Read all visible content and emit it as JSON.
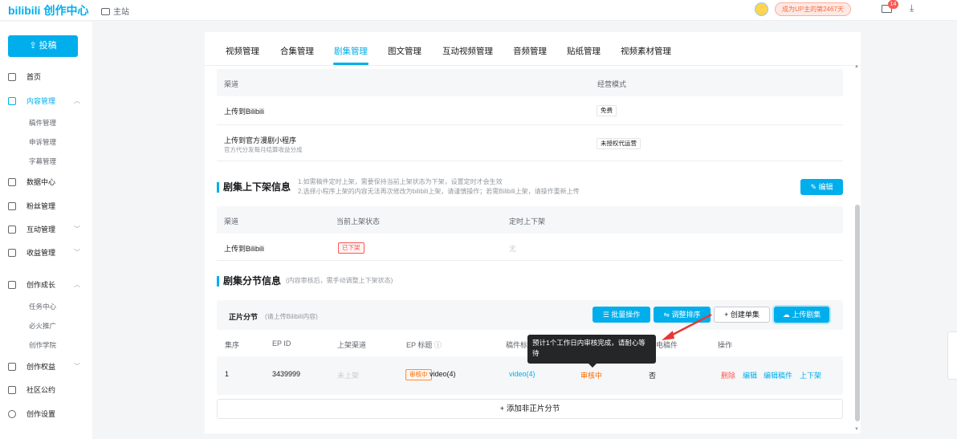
{
  "header": {
    "logo": "bilibili",
    "logo_sub": "创作中心",
    "main_site": "主站",
    "up_badge": "成为UP主的第2467天",
    "mail_count": "14"
  },
  "sidebar": {
    "upload": "投稿",
    "items": [
      {
        "label": "首页"
      },
      {
        "label": "内容管理"
      },
      {
        "label": "稿件管理"
      },
      {
        "label": "申诉管理"
      },
      {
        "label": "字幕管理"
      },
      {
        "label": "数据中心"
      },
      {
        "label": "粉丝管理"
      },
      {
        "label": "互动管理"
      },
      {
        "label": "收益管理"
      },
      {
        "label": "创作成长"
      },
      {
        "label": "任务中心"
      },
      {
        "label": "必火推广"
      },
      {
        "label": "创作学院"
      },
      {
        "label": "创作权益"
      },
      {
        "label": "社区公约"
      },
      {
        "label": "创作设置"
      }
    ]
  },
  "tabs": [
    "视频管理",
    "合集管理",
    "剧集管理",
    "图文管理",
    "互动视频管理",
    "音频管理",
    "贴纸管理",
    "视频素材管理"
  ],
  "channel_table": {
    "headers": [
      "渠道",
      "经营模式"
    ],
    "rows": [
      {
        "channel": "上传到Bilibili",
        "hint": "",
        "mode": "免费"
      },
      {
        "channel": "上传到官方漫剧小程序",
        "hint": "官方代分发每月结算收益分成",
        "mode": "未授权代运营"
      }
    ]
  },
  "shelf_section": {
    "title": "剧集上下架信息",
    "note1": "1.如需稿件定时上架，需要保持当前上架状态为下架，设置定时才会生效",
    "note2": "2.选择小程序上架的内容无法再次修改为bilibili上架，请谨慎操作；若需Bilibili上架，请操作重新上传",
    "edit": "编辑",
    "headers": [
      "渠道",
      "当前上架状态",
      "定时上下架"
    ],
    "row": {
      "channel": "上传到Bilibili",
      "status": "已下架",
      "timed": "无"
    }
  },
  "section_info": {
    "title": "剧集分节信息",
    "note": "(内容审核后，需手动调整上下架状态)",
    "subtitle": "正片分节",
    "subnote": "(请上传Bilibili内容)",
    "buttons": {
      "batch": "批量操作",
      "sort": "调整排序",
      "create": "创建单集",
      "upload": "上传剧集"
    },
    "headers": [
      "集序",
      "EP ID",
      "上架渠道",
      "EP 标题",
      "稿件标",
      "电稿件",
      "操作"
    ],
    "row": {
      "seq": "1",
      "ep_id": "3439999",
      "channel": "未上架",
      "tag": "审核中",
      "title": "video(4)",
      "manuscript": "video(4)",
      "review": "审核中",
      "charge": "否",
      "ops": [
        "删除",
        "编辑",
        "编辑稿件",
        "上下架"
      ]
    },
    "tooltip": "预计1个工作日内审核完成，请耐心等待",
    "add_non": "添加非正片分节"
  },
  "colors": {
    "accent": "#00aeec",
    "danger": "#f85a54",
    "warn": "#ff6a00"
  }
}
